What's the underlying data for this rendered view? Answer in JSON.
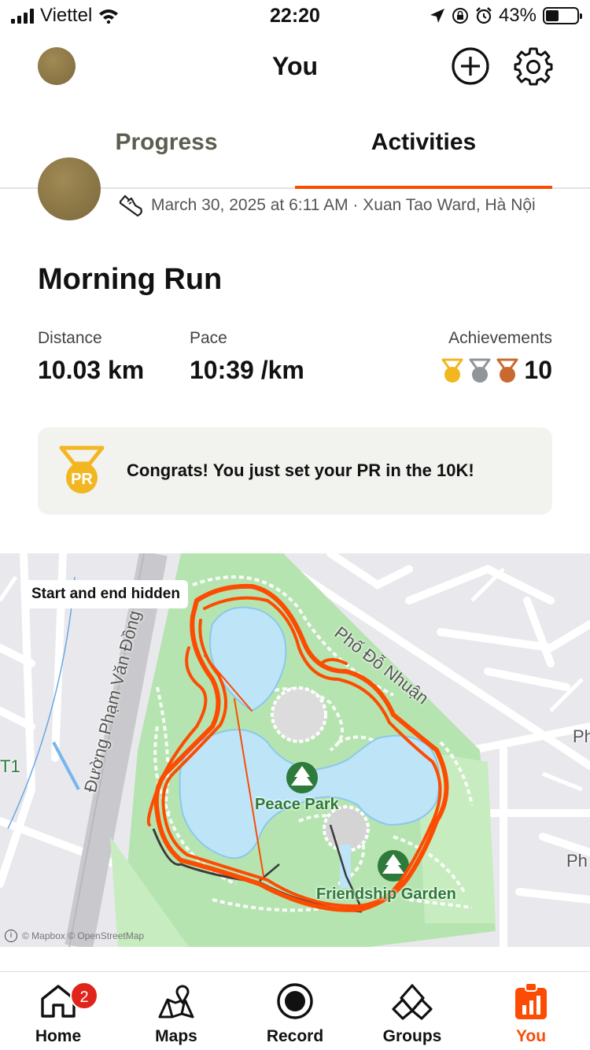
{
  "status_bar": {
    "carrier": "Viettel",
    "time": "22:20",
    "battery": "43%",
    "icons": [
      "signal-icon",
      "wifi-icon",
      "location-arrow-icon",
      "rotation-lock-icon",
      "alarm-icon",
      "battery-icon"
    ]
  },
  "header": {
    "title": "You",
    "icons": [
      "avatar",
      "add-icon",
      "gear-icon"
    ]
  },
  "tabs": [
    {
      "label": "Progress",
      "active": false
    },
    {
      "label": "Activities",
      "active": true
    }
  ],
  "activity": {
    "meta": "March 30, 2025 at 6:11 AM · Xuan Tao Ward, Hà Nội",
    "title": "Morning Run",
    "stats": {
      "distance_label": "Distance",
      "distance_value": "10.03 km",
      "pace_label": "Pace",
      "pace_value": "10:39 /km",
      "achievements_label": "Achievements",
      "achievements_value": "10"
    },
    "medal_colors": {
      "gold": "#f2b620",
      "silver": "#8f9599",
      "bronze": "#c9692f"
    },
    "pr_banner": {
      "text": "Congrats! You just set your PR in the 10K!",
      "badge_text": "PR"
    }
  },
  "map": {
    "chip": "Start and end hidden",
    "attribution": "© Mapbox © OpenStreetMap",
    "labels": {
      "park1": "Peace Park",
      "park2": "Friendship Garden",
      "street1": "Đường Phạm Văn Đồng",
      "street2": "Phố Đỗ Nhuận",
      "edge_left": "T1",
      "edge_right_top": "Ph",
      "edge_right_bottom": "Ph"
    },
    "route_color": "#fc4c02"
  },
  "bottom_nav": {
    "home": "Home",
    "home_badge": "2",
    "maps": "Maps",
    "record": "Record",
    "groups": "Groups",
    "you": "You",
    "active": "You",
    "accent": "#fc4c02"
  }
}
